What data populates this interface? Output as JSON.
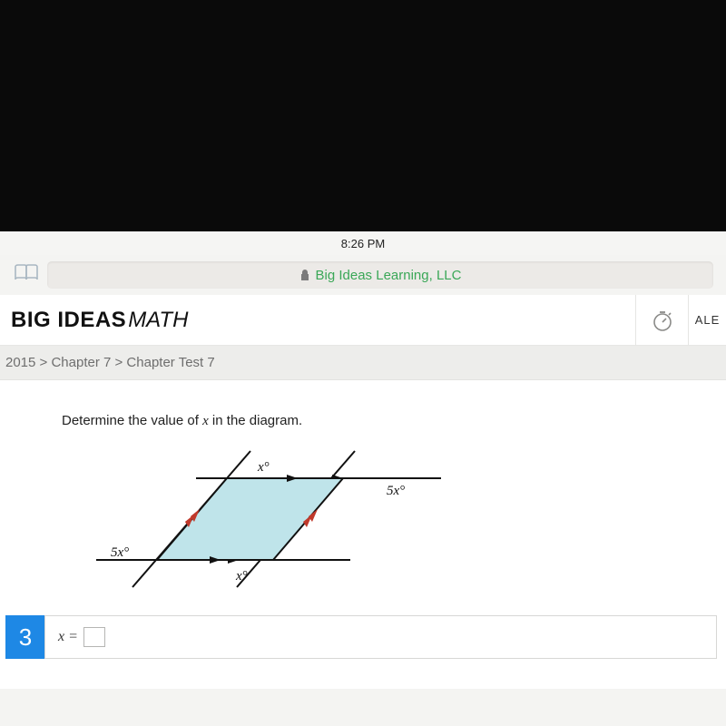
{
  "status_bar": {
    "time": "8:26 PM"
  },
  "url_bar": {
    "site_label": "Big Ideas Learning, LLC"
  },
  "app_header": {
    "brand_big": "BIG IDEAS",
    "brand_math": "MATH",
    "user_partial": "ALE"
  },
  "breadcrumb": "2015 > Chapter 7 > Chapter Test 7",
  "question": {
    "prompt_prefix": "Determine the value of ",
    "prompt_var": "x",
    "prompt_suffix": " in the diagram.",
    "number": "3",
    "answer_label": "x =",
    "diagram_labels": {
      "top_inner": "x°",
      "top_right_outer": "5x°",
      "bottom_left_outer": "5x°",
      "bottom_inner": "x°"
    }
  }
}
